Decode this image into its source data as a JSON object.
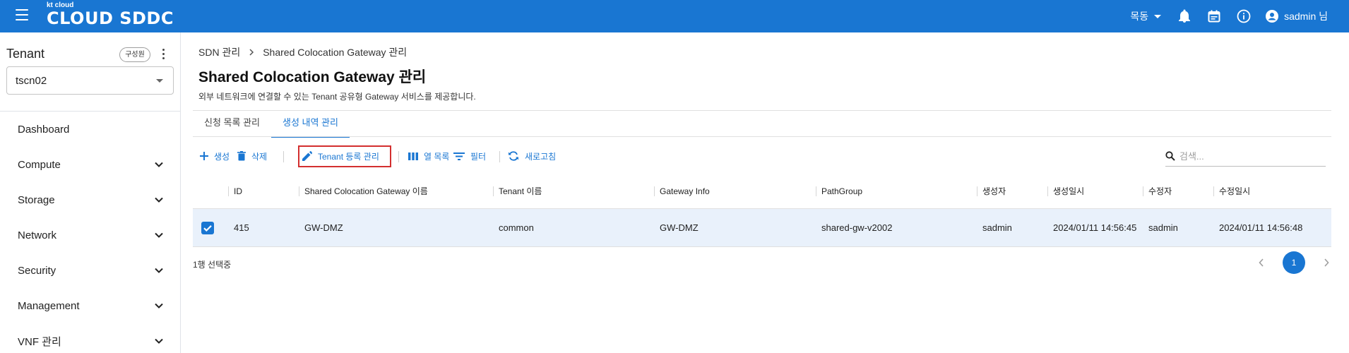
{
  "header": {
    "brand_small": "kt cloud",
    "brand_main": "CLOUD SDDC",
    "region": "목동",
    "user": "sadmin 님",
    "icons": [
      "menu-icon",
      "bell-icon",
      "calendar-icon",
      "info-icon",
      "account-icon"
    ],
    "color": "#1976d2"
  },
  "sidebar": {
    "title": "Tenant",
    "members_chip": "구성원",
    "tenant_value": "tscn02",
    "items": [
      {
        "label": "Dashboard"
      },
      {
        "label": "Compute"
      },
      {
        "label": "Storage"
      },
      {
        "label": "Network"
      },
      {
        "label": "Security"
      },
      {
        "label": "Management"
      },
      {
        "label": "VNF 관리"
      }
    ]
  },
  "main": {
    "breadcrumb": [
      "SDN 관리",
      "Shared Colocation Gateway 관리"
    ],
    "title": "Shared Colocation Gateway 관리",
    "description": "외부 네트워크에 연결할 수 있는 Tenant 공유형 Gateway 서비스를 제공합니다.",
    "tabs": [
      {
        "label": "신청 목록 관리",
        "active": false
      },
      {
        "label": "생성 내역 관리",
        "active": true
      }
    ],
    "toolbar": {
      "create": "생성",
      "delete": "삭제",
      "tenant_register": "Tenant 등록 관리",
      "columns": "열 목록",
      "filter": "필터",
      "refresh": "새로고침",
      "search_placeholder": "검색..."
    },
    "table": {
      "columns": [
        "ID",
        "Shared Colocation Gateway 이름",
        "Tenant 이름",
        "Gateway Info",
        "PathGroup",
        "생성자",
        "생성일시",
        "수정자",
        "수정일시"
      ],
      "rows": [
        {
          "checked": true,
          "cells": [
            "415",
            "GW-DMZ",
            "common",
            "GW-DMZ",
            "shared-gw-v2002",
            "sadmin",
            "2024/01/11 14:56:45",
            "sadmin",
            "2024/01/11 14:56:48"
          ]
        }
      ]
    },
    "selection_status": "1행 선택중",
    "pagination": {
      "current": "1"
    }
  }
}
